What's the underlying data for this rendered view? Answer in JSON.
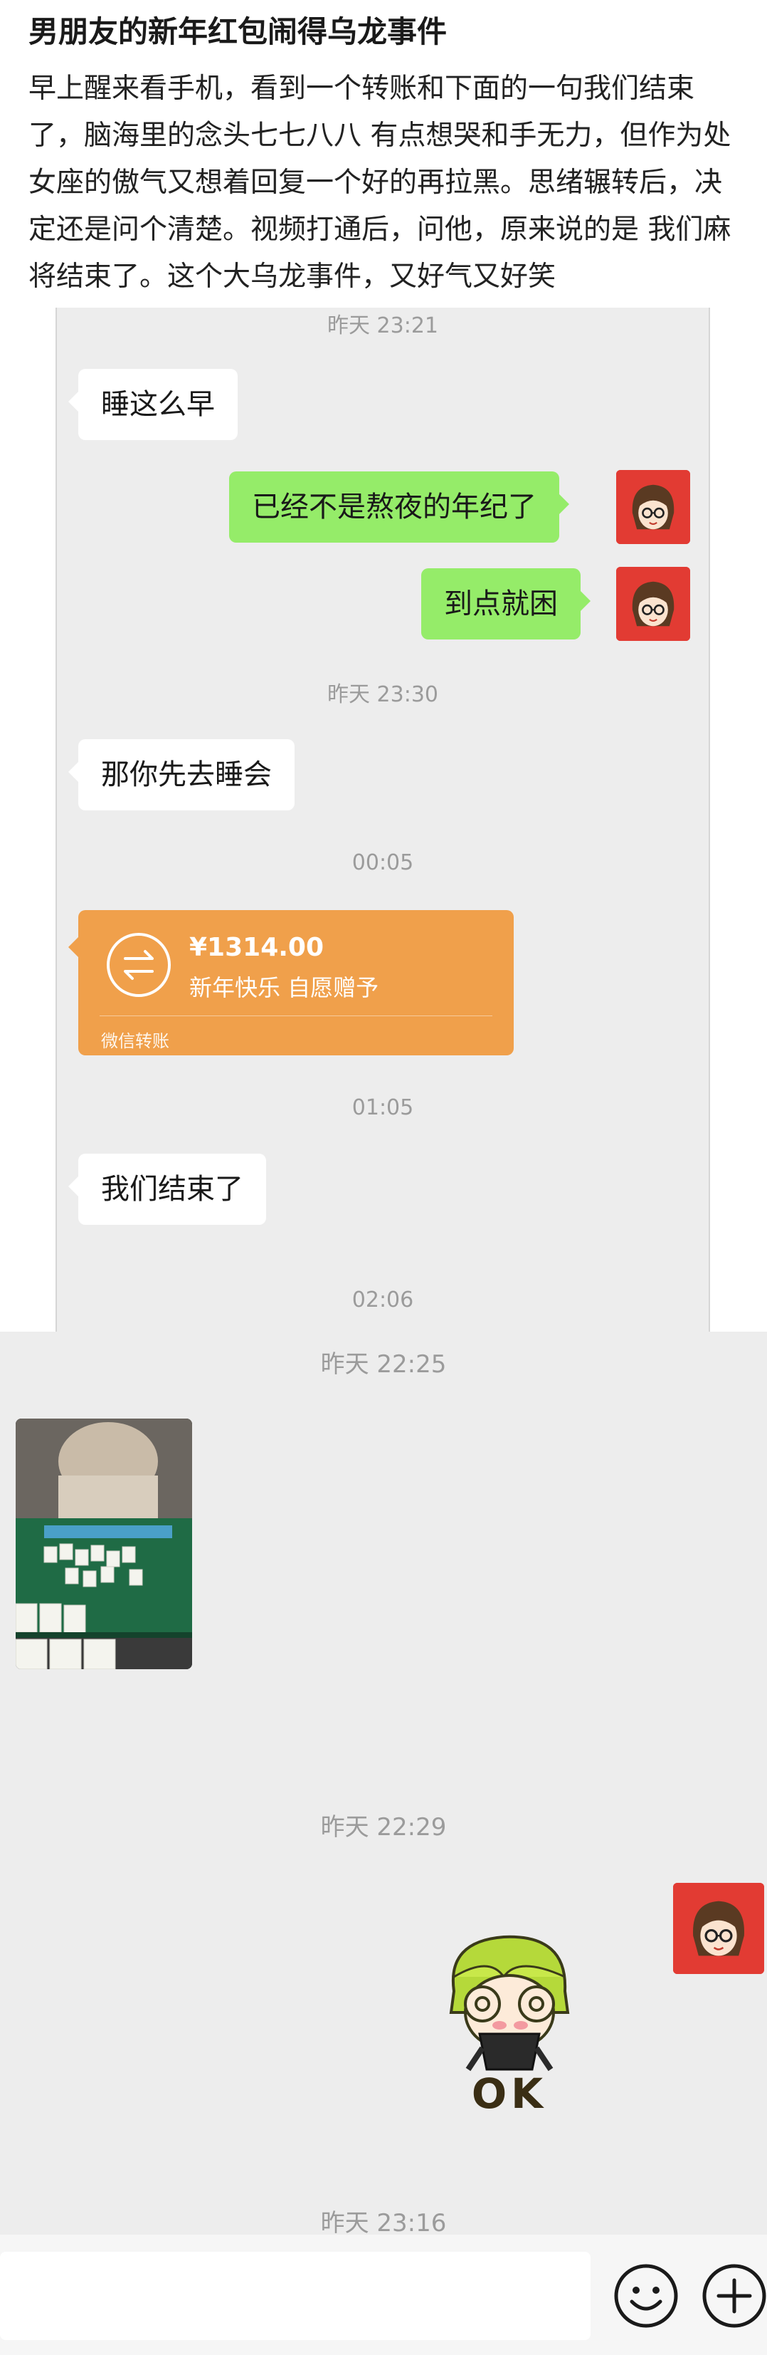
{
  "post": {
    "title": "男朋友的新年红包闹得乌龙事件",
    "body": "早上醒来看手机，看到一个转账和下面的一句我们结束了，脑海里的念头七七八八 有点想哭和手无力，但作为处女座的傲气又想着回复一个好的再拉黑。思绪辗转后，决定还是问个清楚。视频打通后，问他，原来说的是 我们麻将结束了。这个大乌龙事件，又好气又好笑"
  },
  "chat1": {
    "time1": "昨天 23:21",
    "msg1": "睡这么早",
    "msg2": "已经不是熬夜的年纪了",
    "msg3": "到点就困",
    "time2": "昨天 23:30",
    "msg4": "那你先去睡会",
    "time3": "00:05",
    "transfer": {
      "amount": "¥1314.00",
      "note": "新年快乐 自愿赠予",
      "brand": "微信转账"
    },
    "time4": "01:05",
    "msg5": "我们结束了",
    "time5": "02:06"
  },
  "chat2": {
    "time1": "昨天 22:25",
    "time2": "昨天 22:29",
    "sticker_text": "OK",
    "time3": "昨天 23:16"
  },
  "icons": {
    "emoji": "emoji-icon",
    "add": "add-icon",
    "transfer": "transfer-icon"
  },
  "colors": {
    "bubble_self": "#95ec69",
    "bubble_other": "#ffffff",
    "transfer": "#f0a04b",
    "avatar_bg": "#e23b33",
    "chat_bg": "#ededed"
  }
}
